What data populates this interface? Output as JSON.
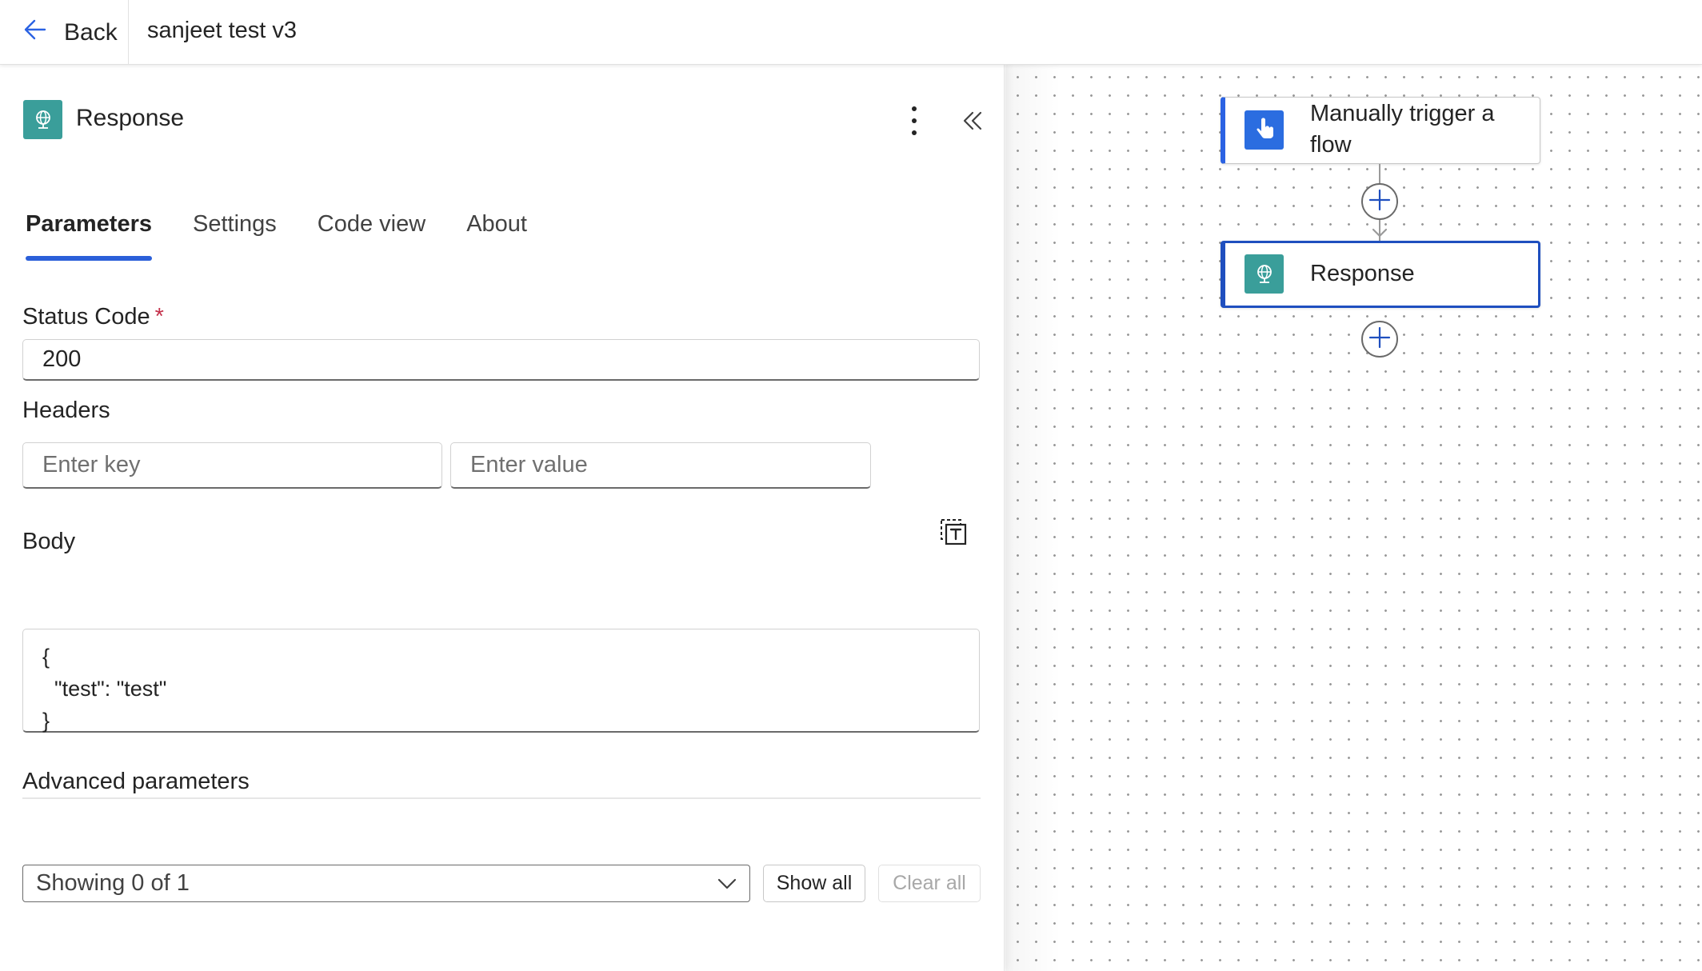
{
  "topbar": {
    "back_label": "Back",
    "flow_title": "sanjeet test v3"
  },
  "panel": {
    "title": "Response",
    "tabs": [
      {
        "label": "Parameters",
        "active": true
      },
      {
        "label": "Settings",
        "active": false
      },
      {
        "label": "Code view",
        "active": false
      },
      {
        "label": "About",
        "active": false
      }
    ],
    "status_code": {
      "label": "Status Code",
      "required_marker": "*",
      "value": "200"
    },
    "headers": {
      "label": "Headers",
      "key_placeholder": "Enter key",
      "value_placeholder": "Enter value"
    },
    "body": {
      "label": "Body",
      "lines": [
        "{",
        "  \"test\": \"test\"",
        "}"
      ]
    },
    "advanced": {
      "label": "Advanced parameters",
      "selected": "Showing 0 of 1",
      "show_all_label": "Show all",
      "clear_all_label": "Clear all"
    }
  },
  "canvas": {
    "nodes": [
      {
        "label": "Manually trigger a flow",
        "icon": "hand-touch-icon",
        "accent": "#2b62e3"
      },
      {
        "label": "Response",
        "icon": "globe-response-icon",
        "accent": "#1f4fbf",
        "selected": true
      }
    ]
  },
  "colors": {
    "accent": "#2b5fd9",
    "response_icon_bg": "#3a9e9a",
    "trigger_icon_bg": "#2b6de0",
    "required": "#c4314b"
  }
}
